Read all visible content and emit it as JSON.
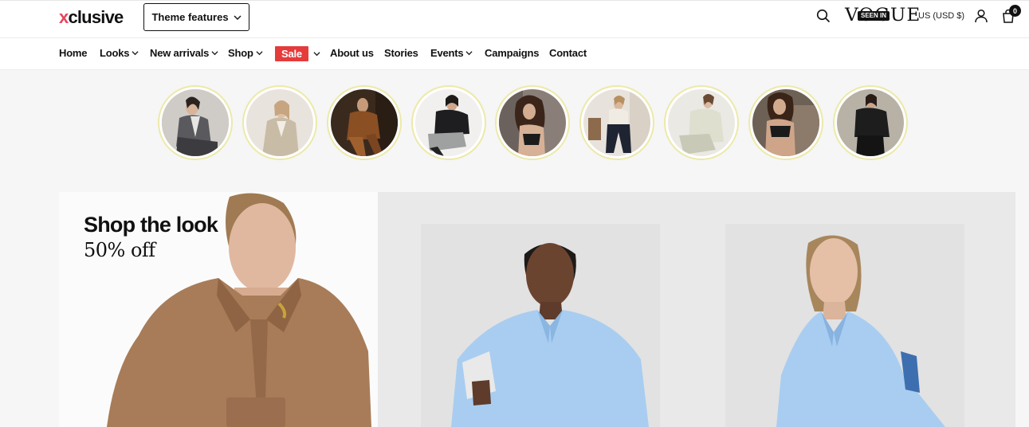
{
  "header": {
    "logo_mark": "x",
    "logo_text": "clusive",
    "theme_button": "Theme features",
    "press_logo": "VOGUE",
    "press_badge": "SEEN IN",
    "currency": "US (USD $)",
    "cart_count": "0"
  },
  "nav": {
    "items": [
      {
        "label": "Home"
      },
      {
        "label": "Looks"
      },
      {
        "label": "New arrivals"
      },
      {
        "label": "Shop"
      },
      {
        "label": "Sale"
      },
      {
        "label": "About us"
      },
      {
        "label": "Stories"
      },
      {
        "label": "Events"
      },
      {
        "label": "Campaigns"
      },
      {
        "label": "Contact"
      }
    ]
  },
  "stories": {
    "count": 9,
    "ring_color": "#ece9a8"
  },
  "hero": {
    "title": "Shop the look",
    "subtitle": "50% off"
  },
  "colors": {
    "brand_accent": "#e8455a",
    "sale": "#e53b3b",
    "shirt_blue": "#a9cdf0",
    "coat_tan": "#a87c58"
  }
}
